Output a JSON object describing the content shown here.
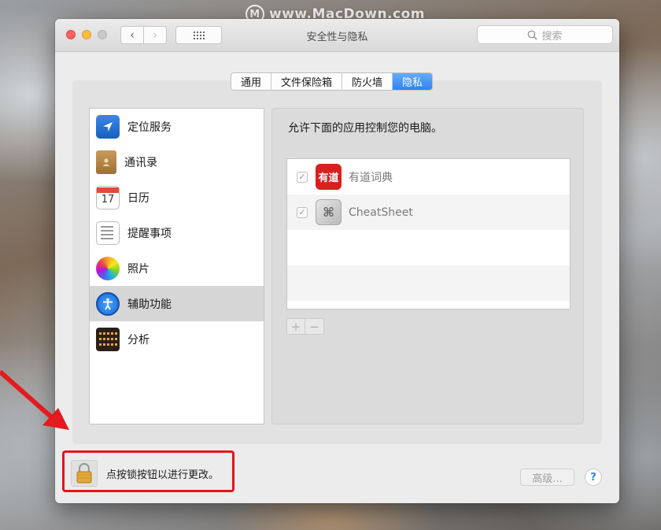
{
  "watermark": {
    "logo_glyph": "M",
    "text": "www.MacDown.com"
  },
  "window": {
    "title": "安全性与隐私",
    "search_placeholder": "搜索"
  },
  "tabs": [
    {
      "label": "通用",
      "active": false
    },
    {
      "label": "文件保险箱",
      "active": false
    },
    {
      "label": "防火墙",
      "active": false
    },
    {
      "label": "隐私",
      "active": true
    }
  ],
  "services": [
    {
      "label": "定位服务",
      "icon": "location-arrow-icon",
      "selected": false
    },
    {
      "label": "通讯录",
      "icon": "contacts-book-icon",
      "selected": false
    },
    {
      "label": "日历",
      "icon": "calendar-icon",
      "selected": false,
      "icon_month": "JUL",
      "icon_day": "17"
    },
    {
      "label": "提醒事项",
      "icon": "reminders-icon",
      "selected": false
    },
    {
      "label": "照片",
      "icon": "photos-icon",
      "selected": false
    },
    {
      "label": "辅助功能",
      "icon": "accessibility-icon",
      "selected": true
    },
    {
      "label": "分析",
      "icon": "analytics-icon",
      "selected": false
    }
  ],
  "detail": {
    "description": "允许下面的应用控制您的电脑。",
    "apps": [
      {
        "name": "有道词典",
        "checked": true,
        "icon": "youdao-dict-icon",
        "icon_text": "有道"
      },
      {
        "name": "CheatSheet",
        "checked": true,
        "icon": "cheatsheet-icon",
        "icon_text": "⌘"
      }
    ],
    "add_label": "+",
    "remove_label": "−"
  },
  "footer": {
    "lock_label": "点按锁按钮以进行更改。",
    "advanced_label": "高级...",
    "help_label": "?"
  },
  "colors": {
    "accent": "#2b84f5",
    "highlight_box": "#e0161b",
    "arrow": "#e31b1f"
  }
}
